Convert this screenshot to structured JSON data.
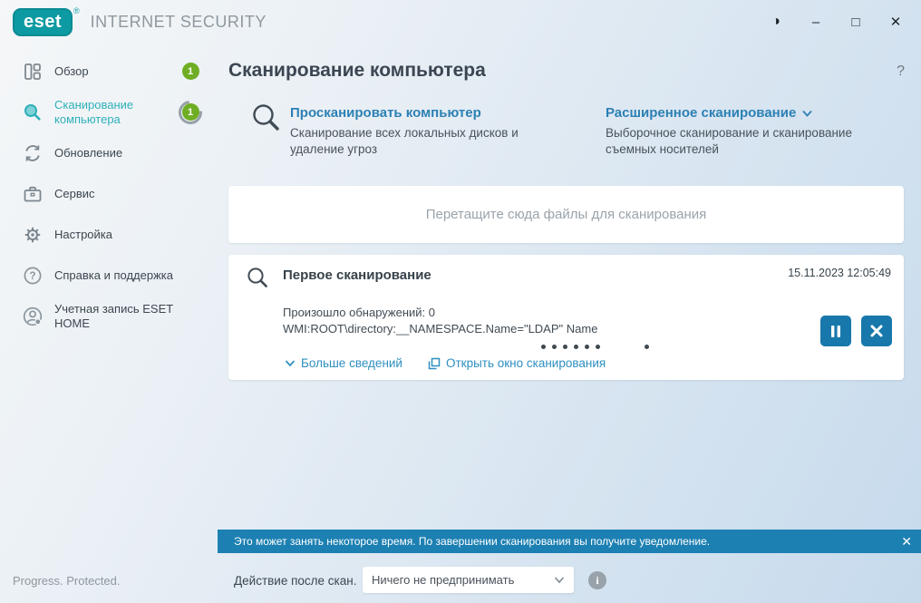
{
  "window": {
    "brand": "eset",
    "registered_mark": "®",
    "product": "INTERNET SECURITY",
    "controls": {
      "contrast": "◑",
      "minimize": "–",
      "maximize": "□",
      "close": "✕"
    }
  },
  "sidebar": {
    "items": [
      {
        "label": "Обзор",
        "icon": "overview-grid-icon",
        "badge": "1"
      },
      {
        "label": "Сканирование компьютера",
        "icon": "search-icon",
        "badge": "1",
        "active": true
      },
      {
        "label": "Обновление",
        "icon": "refresh-icon"
      },
      {
        "label": "Сервис",
        "icon": "toolbox-icon"
      },
      {
        "label": "Настройка",
        "icon": "gear-icon"
      },
      {
        "label": "Справка и поддержка",
        "icon": "question-icon"
      },
      {
        "label": "Учетная запись ESET HOME",
        "icon": "account-icon"
      }
    ]
  },
  "header": {
    "title": "Сканирование компьютера",
    "help": "?"
  },
  "scan_options": [
    {
      "title": "Просканировать компьютер",
      "description": "Сканирование всех локальных дисков и удаление угроз"
    },
    {
      "title": "Расширенное сканирование",
      "description": "Выборочное сканирование и сканирование съемных носителей"
    }
  ],
  "dropzone": {
    "text": "Перетащите сюда файлы для сканирования"
  },
  "scan_card": {
    "title": "Первое сканирование",
    "timestamp": "15.11.2023 12:05:49",
    "detections": "Произошло обнаружений: 0",
    "current_object": "WMI:ROOT\\directory:__NAMESPACE.Name=\"LDAP\" Name",
    "more_details_label": "Больше сведений",
    "open_window_label": "Открыть окно сканирования",
    "progress_dots": 7
  },
  "notification": {
    "text": "Это может занять некоторое время. По завершении сканирования вы получите уведомление.",
    "close": "✕"
  },
  "footer": {
    "slogan": "Progress. Protected.",
    "action_label": "Действие после скан.",
    "action_value": "Ничего не предпринимать",
    "info": "i"
  },
  "colors": {
    "brand_teal": "#0d9aa2",
    "active_teal": "#2fb0ba",
    "badge_green": "#6fae24",
    "button_blue": "#1878ab",
    "link_blue": "#2e8fc0",
    "notification_blue": "#1d80b2"
  }
}
